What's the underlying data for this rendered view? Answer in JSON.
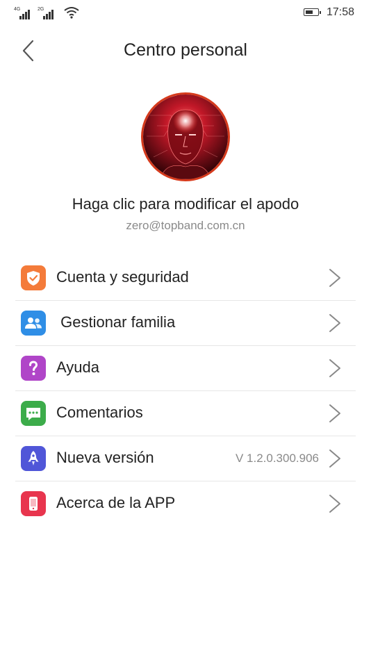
{
  "status_bar": {
    "sim1_tag": "4G",
    "sim2_tag": "2G",
    "time": "17:58"
  },
  "header": {
    "title": "Centro personal",
    "back_icon": "chevron-left-icon"
  },
  "profile": {
    "nickname": "Haga clic para modificar el apodo",
    "email": "zero@topband.com.cn"
  },
  "menu": {
    "items": [
      {
        "label": "Cuenta y seguridad",
        "icon": "shield-icon",
        "color": "#f47b3a"
      },
      {
        "label": " Gestionar familia",
        "icon": "family-icon",
        "color": "#2f8ee6"
      },
      {
        "label": "Ayuda",
        "icon": "help-icon",
        "color": "#b045c8"
      },
      {
        "label": "Comentarios",
        "icon": "comment-icon",
        "color": "#3cac4a"
      },
      {
        "label": "Nueva versión",
        "icon": "rocket-icon",
        "color": "#5056d8",
        "value": "V 1.2.0.300.906"
      },
      {
        "label": "Acerca de la APP",
        "icon": "phone-icon",
        "color": "#e8354e"
      }
    ]
  }
}
